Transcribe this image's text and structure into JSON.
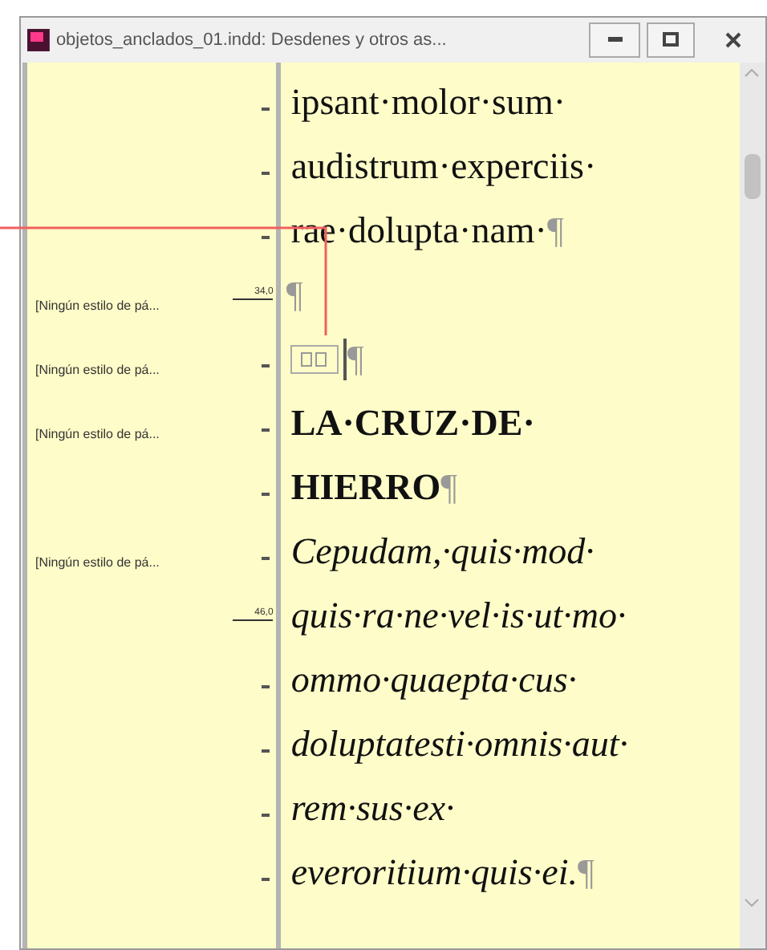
{
  "window": {
    "title": "objetos_anclados_01.indd:  Desdenes y otros as..."
  },
  "lines": [
    {
      "kind": "text",
      "bold": false,
      "italic": false,
      "text": "ipsant·molor·sum·"
    },
    {
      "kind": "text",
      "bold": false,
      "italic": false,
      "text": "audistrum·experciis·"
    },
    {
      "kind": "text",
      "bold": false,
      "italic": false,
      "text": "rae·dolupta·nam·",
      "mark": "¶"
    },
    {
      "kind": "text",
      "mark": "¶",
      "style": "[Ningún estilo de pá...",
      "depth": "34,0"
    },
    {
      "kind": "anchor",
      "mark": "¶",
      "style": "[Ningún estilo de pá..."
    },
    {
      "kind": "text",
      "bold": true,
      "italic": false,
      "text": "LA·CRUZ·DE·",
      "style": "[Ningún estilo de pá..."
    },
    {
      "kind": "text",
      "bold": true,
      "italic": false,
      "text": "HIERRO",
      "mark": "¶"
    },
    {
      "kind": "text",
      "bold": false,
      "italic": true,
      "text": "Cepudam,·quis·mod·",
      "style": "[Ningún estilo de pá..."
    },
    {
      "kind": "text",
      "bold": false,
      "italic": true,
      "text": "quis·ra·ne·vel·is·ut·mo·",
      "depth": "46,0"
    },
    {
      "kind": "text",
      "bold": false,
      "italic": true,
      "text": "ommo·quaepta·cus·"
    },
    {
      "kind": "text",
      "bold": false,
      "italic": true,
      "text": "doluptatesti·omnis·aut·"
    },
    {
      "kind": "text",
      "bold": false,
      "italic": true,
      "text": "rem·sus·ex·"
    },
    {
      "kind": "text",
      "bold": false,
      "italic": true,
      "text": "everoritium·quis·ei.",
      "mark": "¶"
    }
  ]
}
